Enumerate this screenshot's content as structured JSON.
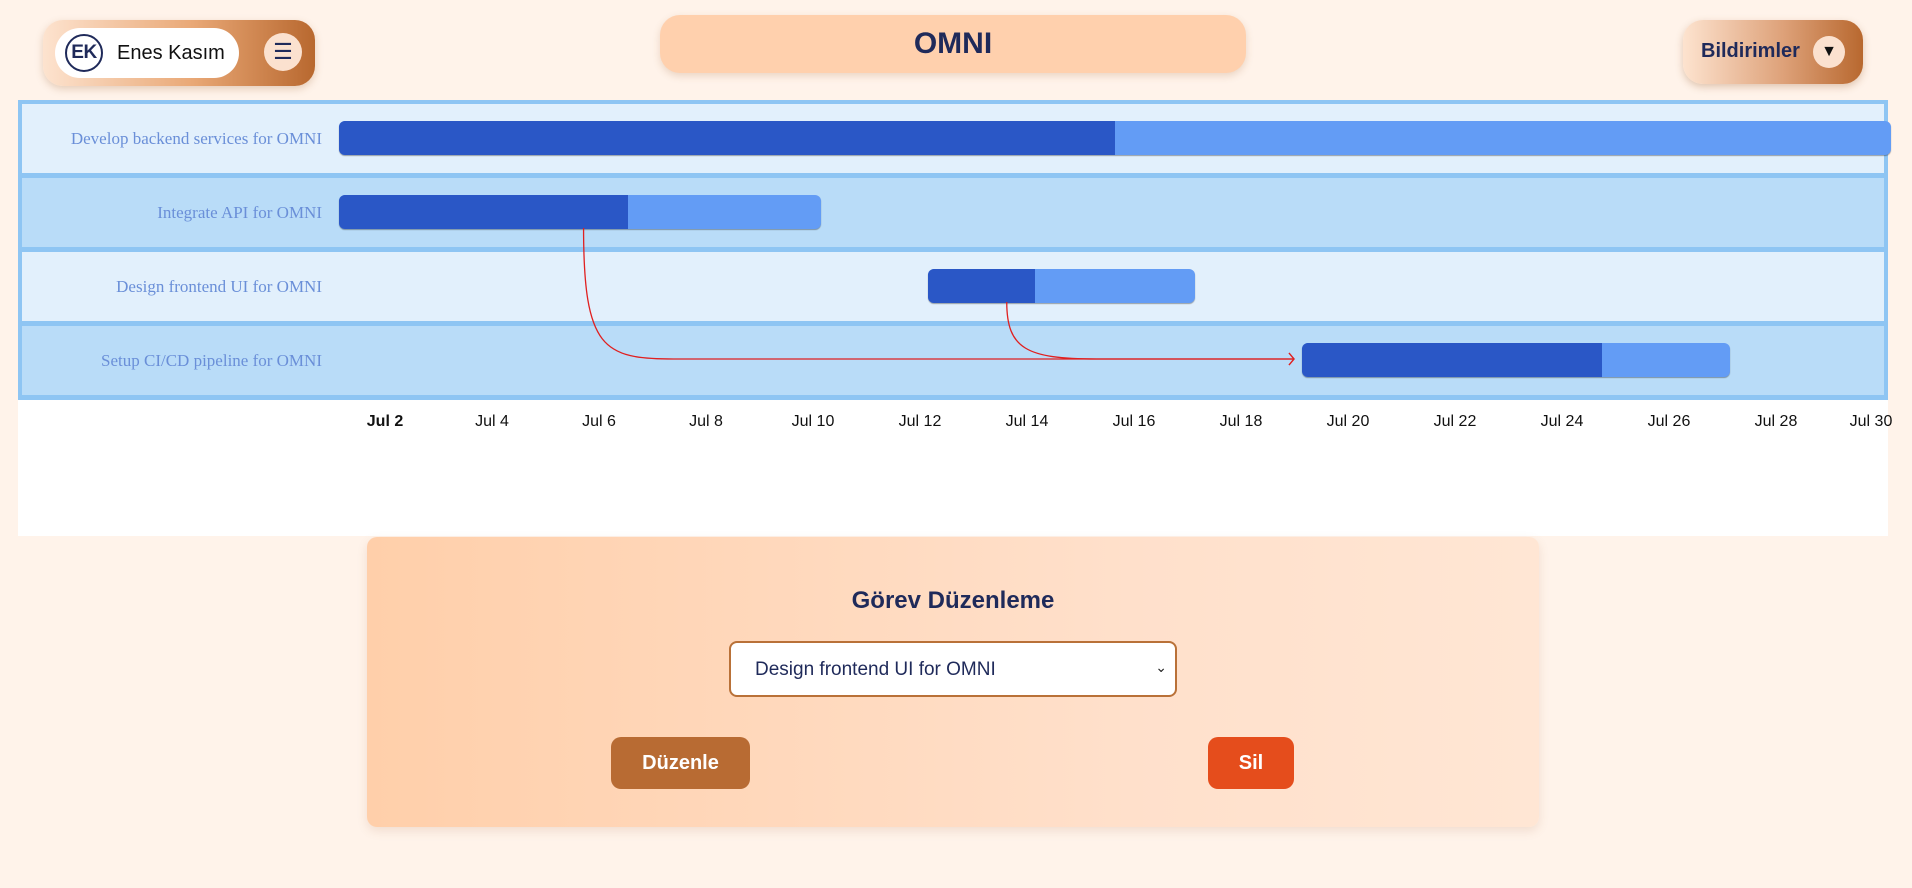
{
  "header": {
    "user": {
      "initials": "EK",
      "name": "Enes Kasım",
      "menu_icon": "☰"
    },
    "app_title": "OMNI",
    "notifications": {
      "label": "Bildirimler",
      "caret": "▼"
    }
  },
  "gantt": {
    "start_date": "Jul 1",
    "tasks": [
      {
        "name": "Develop backend services for OMNI",
        "start_day": 1.0,
        "end_day": 30.0,
        "progress": 0.5
      },
      {
        "name": "Integrate API for OMNI",
        "start_day": 1.0,
        "end_day": 10.0,
        "progress": 0.6
      },
      {
        "name": "Design frontend UI for OMNI",
        "start_day": 12.0,
        "end_day": 17.0,
        "progress": 0.4
      },
      {
        "name": "Setup CI/CD pipeline for OMNI",
        "start_day": 19.0,
        "end_day": 27.0,
        "progress": 0.7
      }
    ],
    "dependencies": [
      {
        "from": "Integrate API for OMNI",
        "to": "Setup CI/CD pipeline for OMNI"
      },
      {
        "from": "Design frontend UI for OMNI",
        "to": "Setup CI/CD pipeline for OMNI"
      }
    ],
    "ticks": [
      "Jul 2",
      "Jul 4",
      "Jul 6",
      "Jul 8",
      "Jul 10",
      "Jul 12",
      "Jul 14",
      "Jul 16",
      "Jul 18",
      "Jul 20",
      "Jul 22",
      "Jul 24",
      "Jul 26",
      "Jul 28",
      "Jul 30"
    ],
    "colors": {
      "row_light": "#e2f0fc",
      "row_dark": "#b9dcf8",
      "bar": "#639cf5",
      "progress": "#2a57c6",
      "dependency": "#e02020"
    }
  },
  "editor": {
    "title": "Görev Düzenleme",
    "selected_task": "Design frontend UI for OMNI",
    "chevron": "⌄",
    "edit_label": "Düzenle",
    "delete_label": "Sil"
  }
}
